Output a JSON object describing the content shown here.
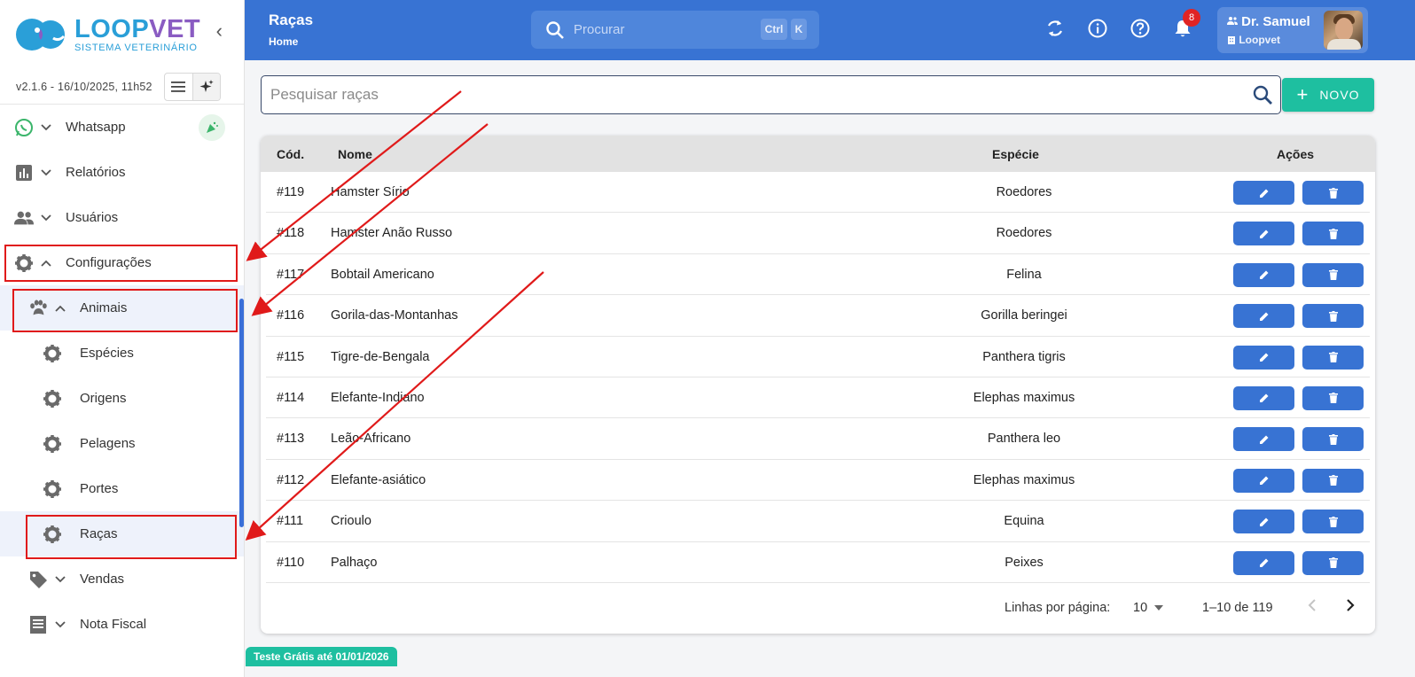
{
  "app": {
    "brand_loop": "LOOP",
    "brand_vet": "VET",
    "brand_sub": "SISTEMA VETERINÁRIO",
    "version": "v2.1.6 - 16/10/2025, 11h52"
  },
  "sidebar": {
    "items": [
      {
        "label": "Whatsapp",
        "icon": "whatsapp-icon"
      },
      {
        "label": "Relatórios",
        "icon": "bar-chart-icon"
      },
      {
        "label": "Usuários",
        "icon": "users-icon"
      },
      {
        "label": "Configurações",
        "icon": "gear-icon"
      },
      {
        "label": "Animais",
        "icon": "paw-icon"
      },
      {
        "label": "Espécies",
        "icon": "gear-icon"
      },
      {
        "label": "Origens",
        "icon": "gear-icon"
      },
      {
        "label": "Pelagens",
        "icon": "gear-icon"
      },
      {
        "label": "Portes",
        "icon": "gear-icon"
      },
      {
        "label": "Raças",
        "icon": "gear-icon"
      },
      {
        "label": "Vendas",
        "icon": "tag-icon"
      },
      {
        "label": "Nota Fiscal",
        "icon": "receipt-icon"
      }
    ]
  },
  "header": {
    "title": "Raças",
    "breadcrumb": "Home",
    "search_placeholder": "Procurar",
    "kbd_ctrl": "Ctrl",
    "kbd_k": "K",
    "notifications": "8",
    "user_name": "Dr. Samuel",
    "user_org": "Loopvet"
  },
  "main": {
    "search_placeholder": "Pesquisar raças",
    "new_button": "NOVO",
    "columns": {
      "code": "Cód.",
      "name": "Nome",
      "species": "Espécie",
      "actions": "Ações"
    },
    "rows": [
      {
        "code": "#119",
        "name": "Hamster Sírio",
        "species": "Roedores"
      },
      {
        "code": "#118",
        "name": "Hamster Anão Russo",
        "species": "Roedores"
      },
      {
        "code": "#117",
        "name": "Bobtail Americano",
        "species": "Felina"
      },
      {
        "code": "#116",
        "name": "Gorila-das-Montanhas",
        "species": "Gorilla beringei"
      },
      {
        "code": "#115",
        "name": "Tigre-de-Bengala",
        "species": "Panthera tigris"
      },
      {
        "code": "#114",
        "name": "Elefante-Indiano",
        "species": "Elephas maximus"
      },
      {
        "code": "#113",
        "name": "Leão-Africano",
        "species": "Panthera leo"
      },
      {
        "code": "#112",
        "name": "Elefante-asiático",
        "species": "Elephas maximus"
      },
      {
        "code": "#111",
        "name": "Crioulo",
        "species": "Equina"
      },
      {
        "code": "#110",
        "name": "Palhaço",
        "species": "Peixes"
      }
    ],
    "pagination": {
      "rows_per_page_label": "Linhas por página:",
      "rows_per_page": "10",
      "range": "1–10 de 119"
    }
  },
  "trial_banner": "Teste Grátis até 01/01/2026",
  "colors": {
    "primary": "#3873d3",
    "accent": "#1ebfa0",
    "annotation": "#e01a1a"
  }
}
